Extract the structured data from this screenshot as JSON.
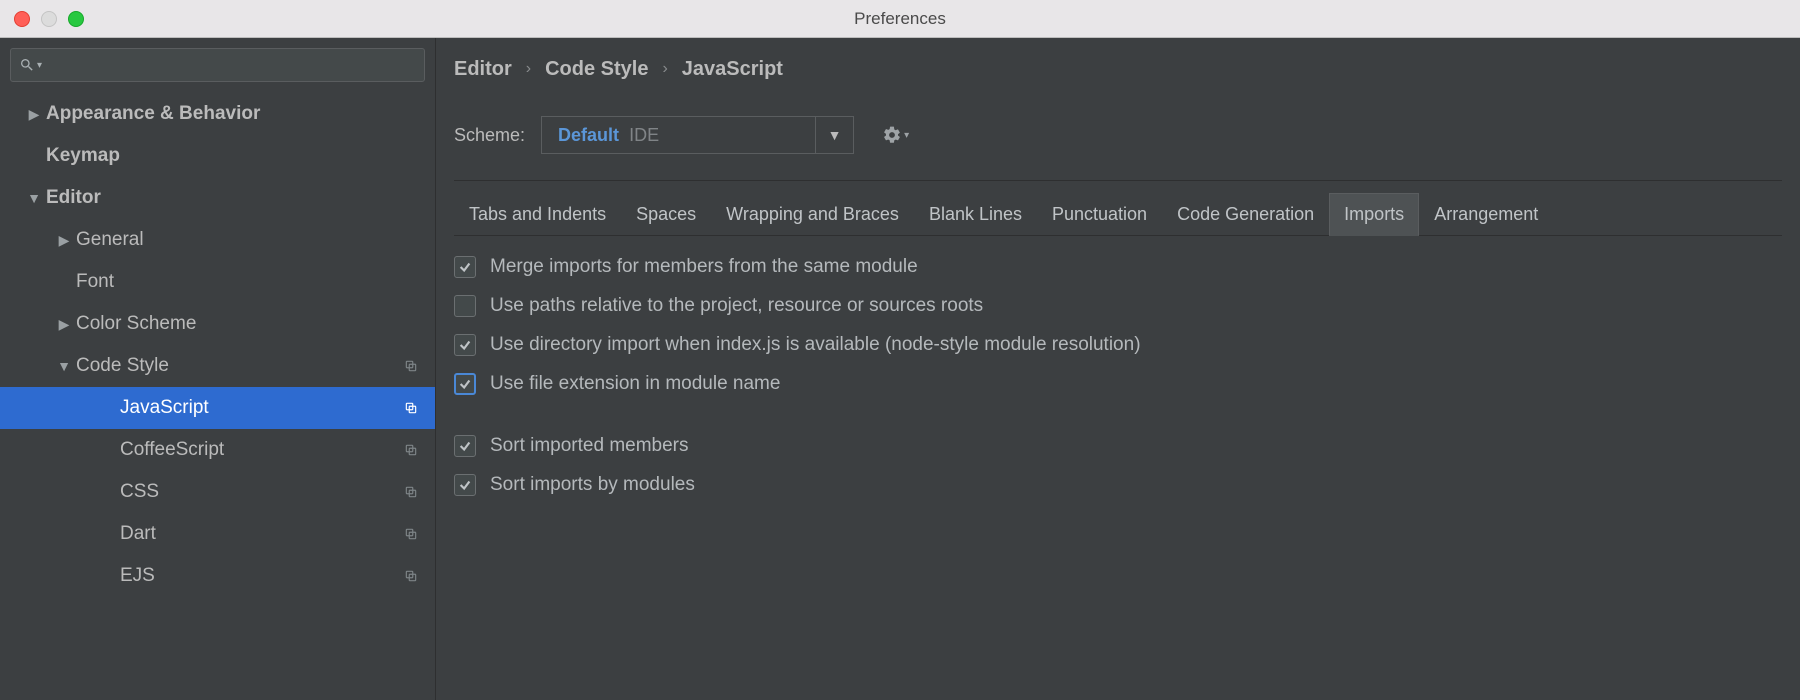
{
  "window": {
    "title": "Preferences"
  },
  "sidebar": {
    "items": [
      {
        "label": "Appearance & Behavior",
        "indent": 0,
        "bold": true,
        "arrow": "right",
        "hasCopy": false,
        "selected": false
      },
      {
        "label": "Keymap",
        "indent": 0,
        "bold": true,
        "arrow": "none",
        "hasCopy": false,
        "selected": false
      },
      {
        "label": "Editor",
        "indent": 0,
        "bold": true,
        "arrow": "down",
        "hasCopy": false,
        "selected": false
      },
      {
        "label": "General",
        "indent": 1,
        "bold": false,
        "arrow": "right",
        "hasCopy": false,
        "selected": false
      },
      {
        "label": "Font",
        "indent": 1,
        "bold": false,
        "arrow": "none",
        "hasCopy": false,
        "selected": false
      },
      {
        "label": "Color Scheme",
        "indent": 1,
        "bold": false,
        "arrow": "right",
        "hasCopy": false,
        "selected": false
      },
      {
        "label": "Code Style",
        "indent": 1,
        "bold": false,
        "arrow": "down",
        "hasCopy": true,
        "selected": false
      },
      {
        "label": "JavaScript",
        "indent": 2,
        "bold": false,
        "arrow": "none",
        "hasCopy": true,
        "selected": true
      },
      {
        "label": "CoffeeScript",
        "indent": 2,
        "bold": false,
        "arrow": "none",
        "hasCopy": true,
        "selected": false
      },
      {
        "label": "CSS",
        "indent": 2,
        "bold": false,
        "arrow": "none",
        "hasCopy": true,
        "selected": false
      },
      {
        "label": "Dart",
        "indent": 2,
        "bold": false,
        "arrow": "none",
        "hasCopy": true,
        "selected": false
      },
      {
        "label": "EJS",
        "indent": 2,
        "bold": false,
        "arrow": "none",
        "hasCopy": true,
        "selected": false
      }
    ]
  },
  "breadcrumb": {
    "a": "Editor",
    "b": "Code Style",
    "c": "JavaScript"
  },
  "scheme": {
    "label": "Scheme:",
    "value": "Default",
    "tag": "IDE"
  },
  "tabs": [
    {
      "label": "Tabs and Indents",
      "active": false
    },
    {
      "label": "Spaces",
      "active": false
    },
    {
      "label": "Wrapping and Braces",
      "active": false
    },
    {
      "label": "Blank Lines",
      "active": false
    },
    {
      "label": "Punctuation",
      "active": false
    },
    {
      "label": "Code Generation",
      "active": false
    },
    {
      "label": "Imports",
      "active": true
    },
    {
      "label": "Arrangement",
      "active": false
    }
  ],
  "options": [
    {
      "label": "Merge imports for members from the same module",
      "checked": true,
      "focused": false
    },
    {
      "label": "Use paths relative to the project, resource or sources roots",
      "checked": false,
      "focused": false
    },
    {
      "label": "Use directory import when index.js is available (node-style module resolution)",
      "checked": true,
      "focused": false
    },
    {
      "label": "Use file extension in module name",
      "checked": true,
      "focused": true
    },
    {
      "gap": true
    },
    {
      "label": "Sort imported members",
      "checked": true,
      "focused": false
    },
    {
      "label": "Sort imports by modules",
      "checked": true,
      "focused": false
    }
  ]
}
